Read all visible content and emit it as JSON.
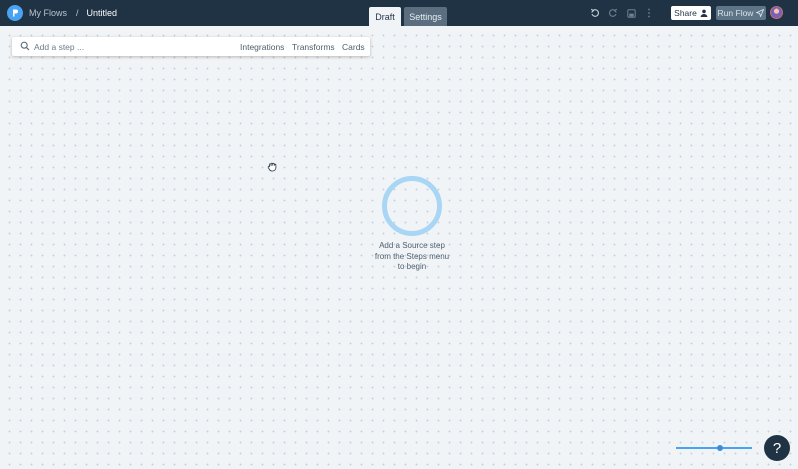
{
  "header": {
    "breadcrumb_root": "My Flows",
    "breadcrumb_separator": "/",
    "flow_title": "Untitled",
    "tabs": [
      {
        "label": "Draft",
        "active": true
      },
      {
        "label": "Settings",
        "active": false
      }
    ],
    "share_label": "Share",
    "run_label": "Run Flow"
  },
  "stepbar": {
    "placeholder": "Add a step ...",
    "links": [
      "Integrations",
      "Transforms",
      "Cards"
    ]
  },
  "canvas": {
    "hint_lines": [
      "Add a Source step",
      "from the Steps menu",
      "to begin"
    ]
  },
  "help": {
    "label": "?"
  },
  "colors": {
    "topbar": "#1f3345",
    "accent": "#4aa3f0",
    "ring": "#a9d6f5",
    "canvas": "#f1f4f7"
  },
  "icons": [
    "logo-icon",
    "undo-icon",
    "redo-icon",
    "save-icon",
    "more-icon",
    "user-icon",
    "send-icon",
    "search-icon",
    "grab-hand-icon"
  ]
}
